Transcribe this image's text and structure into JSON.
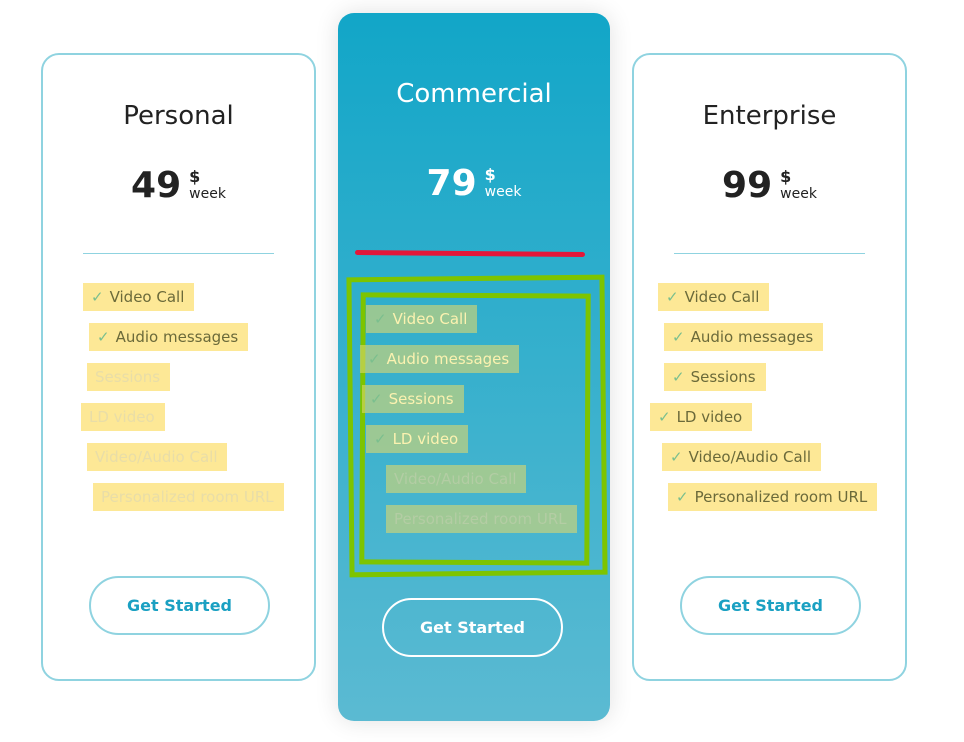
{
  "plans": [
    {
      "name": "Personal",
      "price": "49",
      "currency": "$",
      "period": "week",
      "cta": "Get Started",
      "features": [
        {
          "label": "Video Call",
          "included": true
        },
        {
          "label": "Audio messages",
          "included": true
        },
        {
          "label": "Sessions",
          "included": false
        },
        {
          "label": "LD video",
          "included": false
        },
        {
          "label": "Video/Audio Call",
          "included": false
        },
        {
          "label": "Personalized room URL",
          "included": false
        }
      ]
    },
    {
      "name": "Commercial",
      "price": "79",
      "currency": "$",
      "period": "week",
      "cta": "Get Started",
      "features": [
        {
          "label": "Video Call",
          "included": true
        },
        {
          "label": "Audio messages",
          "included": true
        },
        {
          "label": "Sessions",
          "included": true
        },
        {
          "label": "LD video",
          "included": true
        },
        {
          "label": "Video/Audio Call",
          "included": false
        },
        {
          "label": "Personalized room URL",
          "included": false
        }
      ]
    },
    {
      "name": "Enterprise",
      "price": "99",
      "currency": "$",
      "period": "week",
      "cta": "Get Started",
      "features": [
        {
          "label": "Video Call",
          "included": true
        },
        {
          "label": "Audio messages",
          "included": true
        },
        {
          "label": "Sessions",
          "included": true
        },
        {
          "label": "LD video",
          "included": true
        },
        {
          "label": "Video/Audio Call",
          "included": true
        },
        {
          "label": "Personalized room URL",
          "included": true
        }
      ]
    }
  ],
  "check_glyph": "✓",
  "colors": {
    "accent": "#1aa0c2",
    "border": "#8fd3e0",
    "highlight": "#fde278",
    "annotation_red": "#e3173a",
    "annotation_green": "#7dc400"
  }
}
